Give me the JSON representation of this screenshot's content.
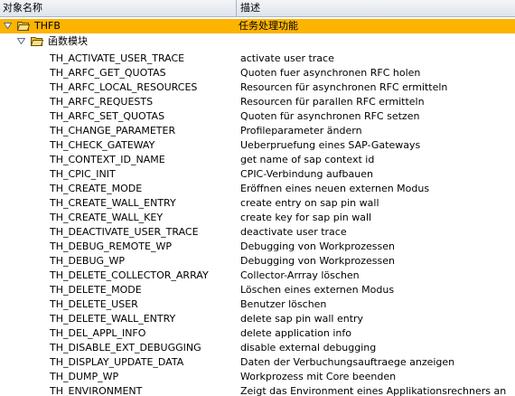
{
  "columns": {
    "name": "对象名称",
    "description": "描述"
  },
  "root": {
    "name": "THFB",
    "description": "任务处理功能"
  },
  "group": {
    "name": "函数模块"
  },
  "items": [
    {
      "name": "TH_ACTIVATE_USER_TRACE",
      "description": "activate user trace"
    },
    {
      "name": "TH_ARFC_GET_QUOTAS",
      "description": "Quoten fuer asynchronen RFC holen"
    },
    {
      "name": "TH_ARFC_LOCAL_RESOURCES",
      "description": "Resourcen für asynchronen RFC ermitteln"
    },
    {
      "name": "TH_ARFC_REQUESTS",
      "description": "Resourcen für parallen RFC ermitteln"
    },
    {
      "name": "TH_ARFC_SET_QUOTAS",
      "description": "Quoten für asynchronen RFC setzen"
    },
    {
      "name": "TH_CHANGE_PARAMETER",
      "description": "Profileparameter ändern"
    },
    {
      "name": "TH_CHECK_GATEWAY",
      "description": "Ueberpruefung eines SAP-Gateways"
    },
    {
      "name": "TH_CONTEXT_ID_NAME",
      "description": "get name of sap context id"
    },
    {
      "name": "TH_CPIC_INIT",
      "description": "CPIC-Verbindung aufbauen"
    },
    {
      "name": "TH_CREATE_MODE",
      "description": "Eröffnen eines neuen externen Modus"
    },
    {
      "name": "TH_CREATE_WALL_ENTRY",
      "description": "create entry on sap pin wall"
    },
    {
      "name": "TH_CREATE_WALL_KEY",
      "description": "create key for sap pin wall"
    },
    {
      "name": "TH_DEACTIVATE_USER_TRACE",
      "description": "deactivate user trace"
    },
    {
      "name": "TH_DEBUG_REMOTE_WP",
      "description": "Debugging von Workprozessen"
    },
    {
      "name": "TH_DEBUG_WP",
      "description": "Debugging von Workprozessen"
    },
    {
      "name": "TH_DELETE_COLLECTOR_ARRAY",
      "description": "Collector-Arrray löschen"
    },
    {
      "name": "TH_DELETE_MODE",
      "description": "Löschen eines externen Modus"
    },
    {
      "name": "TH_DELETE_USER",
      "description": "Benutzer löschen"
    },
    {
      "name": "TH_DELETE_WALL_ENTRY",
      "description": "delete sap pin wall entry"
    },
    {
      "name": "TH_DEL_APPL_INFO",
      "description": "delete application info"
    },
    {
      "name": "TH_DISABLE_EXT_DEBUGGING",
      "description": "disable external debugging"
    },
    {
      "name": "TH_DISPLAY_UPDATE_DATA",
      "description": "Daten der Verbuchungsauftraege anzeigen"
    },
    {
      "name": "TH_DUMP_WP",
      "description": "Workprozess mit Core beenden"
    },
    {
      "name": "TH_ENVIRONMENT",
      "description": "Zeigt das Environment eines Applikationsrechners an"
    }
  ],
  "colors": {
    "selection": "#fdb400",
    "header_bg": "#dfe4ec",
    "folder": "#f5c443"
  }
}
